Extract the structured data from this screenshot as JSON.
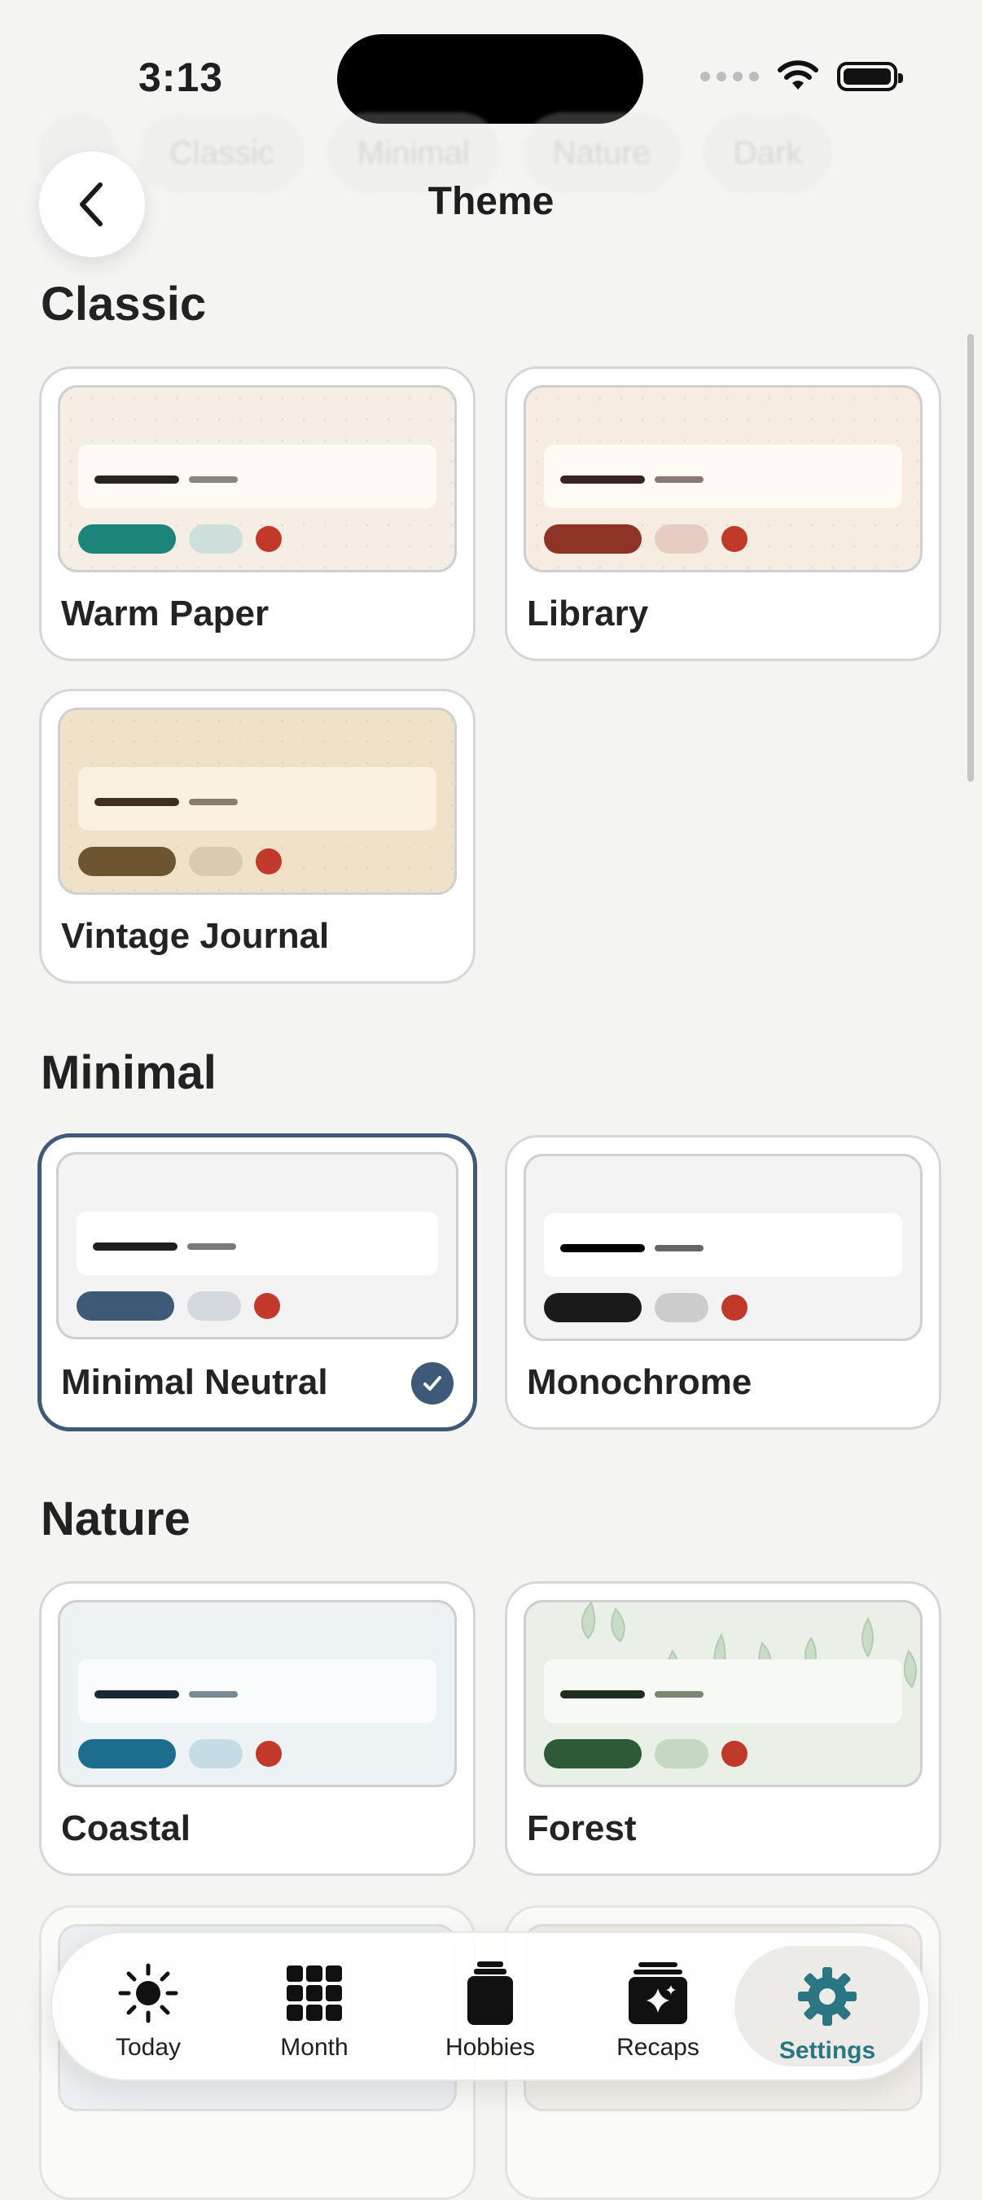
{
  "status": {
    "time": "3:13"
  },
  "chips": [
    "Classic",
    "Minimal",
    "Nature",
    "Dark"
  ],
  "header": {
    "title": "Theme",
    "back_icon": "chevron-left-icon"
  },
  "sections": {
    "classic": {
      "title": "Classic",
      "themes": [
        {
          "name": "Warm Paper",
          "colors": {
            "bg": "#f5eee4",
            "bar": "#fffaf3",
            "line1": "#2a2420",
            "line2": "#8a8480",
            "pill1": "#1c8479",
            "pill2": "#cfe0dc",
            "dot": "#c0392b"
          }
        },
        {
          "name": "Library",
          "colors": {
            "bg": "#f6ece2",
            "bar": "#fffaf2",
            "line1": "#3a2420",
            "line2": "#8a7a74",
            "pill1": "#8e3427",
            "pill2": "#e6cdc4",
            "dot": "#c0392b"
          }
        },
        {
          "name": "Vintage Journal",
          "colors": {
            "bg": "#f0e2c8",
            "bar": "#faf1e0",
            "line1": "#3e3020",
            "line2": "#8a7e6c",
            "pill1": "#6c5530",
            "pill2": "#d8cbb0",
            "dot": "#c0392b"
          }
        }
      ]
    },
    "minimal": {
      "title": "Minimal",
      "themes": [
        {
          "name": "Minimal Neutral",
          "selected": true,
          "colors": {
            "bg": "#f3f3f3",
            "bar": "#ffffff",
            "line1": "#1e1e1e",
            "line2": "#7a7a7a",
            "pill1": "#3d5a78",
            "pill2": "#d3d9dd",
            "dot": "#c0392b"
          }
        },
        {
          "name": "Monochrome",
          "colors": {
            "bg": "#f3f3f3",
            "bar": "#ffffff",
            "line1": "#000000",
            "line2": "#666666",
            "pill1": "#1a1a1a",
            "pill2": "#cccccc",
            "dot": "#c0392b"
          }
        }
      ]
    },
    "nature": {
      "title": "Nature",
      "themes": [
        {
          "name": "Coastal",
          "colors": {
            "bg": "#edf2f4",
            "bar": "#f9fbfc",
            "line1": "#1a2a34",
            "line2": "#7a8a92",
            "pill1": "#1d6e8e",
            "pill2": "#c6dce4",
            "dot": "#c0392b"
          }
        },
        {
          "name": "Forest",
          "colors": {
            "bg": "#eaf0e8",
            "bar": "#f6f9f4",
            "line1": "#1f2e1e",
            "line2": "#7a8676",
            "pill1": "#2e5a38",
            "pill2": "#c6d8c4",
            "dot": "#c0392b"
          }
        }
      ]
    }
  },
  "tabs": [
    {
      "label": "Today",
      "icon": "sun-icon"
    },
    {
      "label": "Month",
      "icon": "grid-icon"
    },
    {
      "label": "Hobbies",
      "icon": "jar-icon"
    },
    {
      "label": "Recaps",
      "icon": "sparkle-stack-icon"
    },
    {
      "label": "Settings",
      "icon": "gear-icon",
      "active": true
    }
  ],
  "accent": "#2a7682",
  "selected_border": "#3e5a78"
}
